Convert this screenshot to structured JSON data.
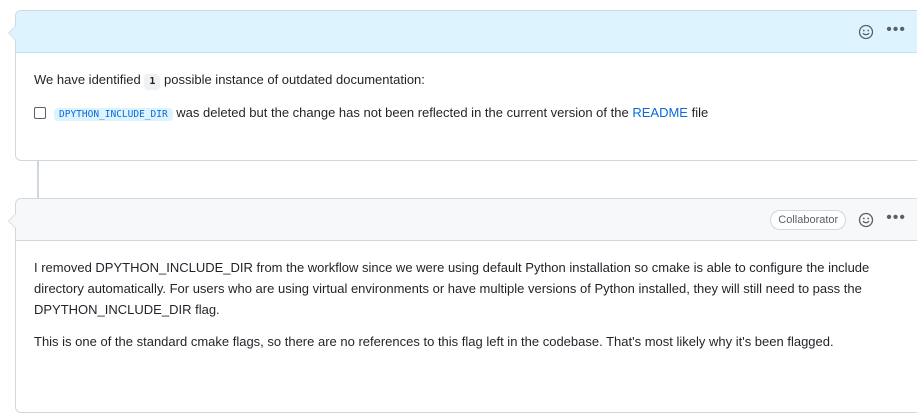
{
  "comment1": {
    "intro_before": "We have identified",
    "count": "1",
    "intro_after": "possible instance of outdated documentation:",
    "task": {
      "code": "DPYTHON_INCLUDE_DIR",
      "text_before": "was deleted but the change has not been reflected in the current version of the",
      "link": "README",
      "text_after": "file"
    },
    "icons": {
      "reaction": "smiley-icon",
      "menu": "kebab-horizontal-icon"
    },
    "header_color": "#ddf4ff"
  },
  "comment2": {
    "badge": "Collaborator",
    "paragraphs": [
      "I removed DPYTHON_INCLUDE_DIR from the workflow since we were using default Python installation so cmake is able to configure the include directory automatically. For users who are using virtual environments or have multiple versions of Python installed, they will still need to pass the DPYTHON_INCLUDE_DIR flag.",
      "This is one of the standard cmake flags, so there are no references to this flag left in the codebase. That's most likely why it's been flagged."
    ],
    "icons": {
      "reaction": "smiley-icon",
      "menu": "kebab-horizontal-icon"
    },
    "header_color": "#f6f8fa"
  },
  "colors": {
    "link": "#0969da",
    "border": "#d0d7de",
    "text": "#1f2328",
    "muted": "#57606a"
  }
}
